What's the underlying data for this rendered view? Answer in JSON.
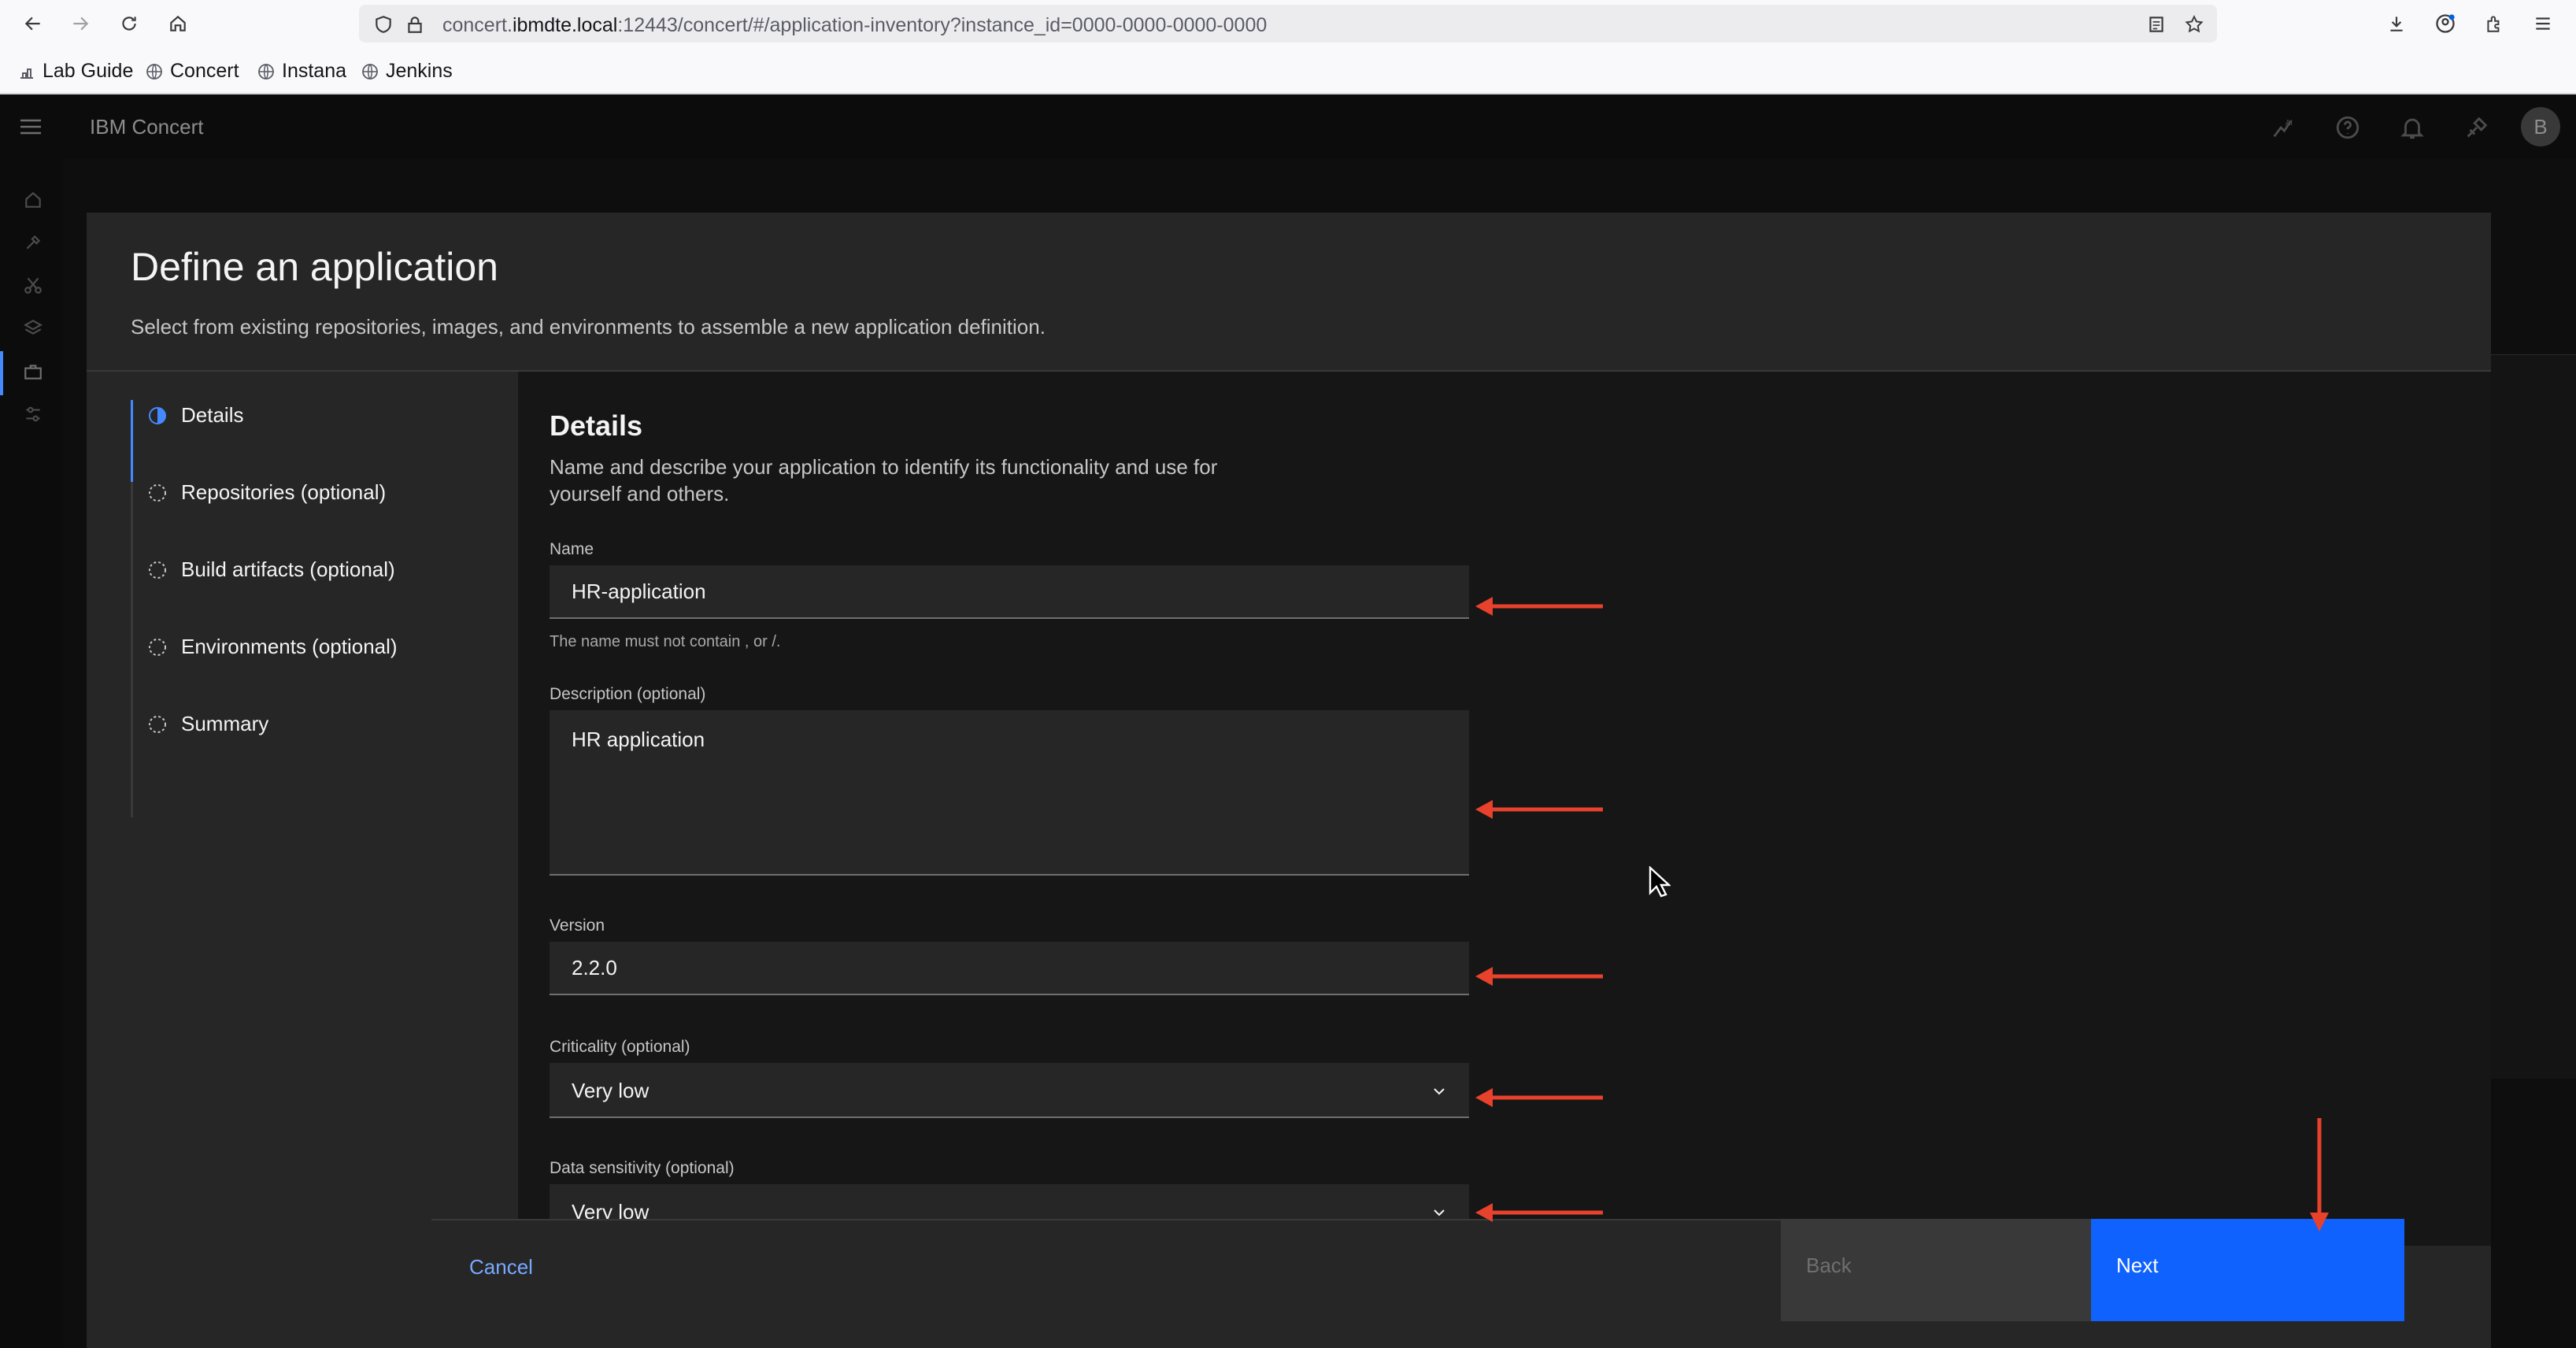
{
  "browser": {
    "url_prefix": "concert.",
    "url_host": "ibmdte.local",
    "url_rest": ":12443/concert/#/application-inventory?instance_id=0000-0000-0000-0000",
    "bookmarks": [
      {
        "label": "Lab Guide",
        "icon": "lab-icon"
      },
      {
        "label": "Concert",
        "icon": "globe-icon"
      },
      {
        "label": "Instana",
        "icon": "globe-icon"
      },
      {
        "label": "Jenkins",
        "icon": "globe-icon"
      }
    ]
  },
  "app": {
    "brand": "IBM Concert",
    "avatar_initial": "B"
  },
  "modal": {
    "title": "Define an application",
    "subtitle": "Select from existing repositories, images, and environments to assemble a new application definition.",
    "steps": [
      {
        "label": "Details",
        "state": "current"
      },
      {
        "label": "Repositories (optional)",
        "state": "incomplete"
      },
      {
        "label": "Build artifacts (optional)",
        "state": "incomplete"
      },
      {
        "label": "Environments (optional)",
        "state": "incomplete"
      },
      {
        "label": "Summary",
        "state": "incomplete"
      }
    ],
    "section_title": "Details",
    "section_desc": "Name and describe your application to identify its functionality and use for yourself and others.",
    "fields": {
      "name_label": "Name",
      "name_value": "HR-application",
      "name_helper": "The name must not contain , or /.",
      "description_label": "Description (optional)",
      "description_value": "HR application",
      "version_label": "Version",
      "version_value": "2.2.0",
      "criticality_label": "Criticality (optional)",
      "criticality_value": "Very low",
      "sensitivity_label": "Data sensitivity (optional)",
      "sensitivity_value": "Very low"
    },
    "footer": {
      "cancel": "Cancel",
      "back": "Back",
      "next": "Next"
    }
  },
  "colors": {
    "accent": "#0f62fe",
    "annotation_arrow": "#e8412c",
    "link": "#78a9ff"
  }
}
